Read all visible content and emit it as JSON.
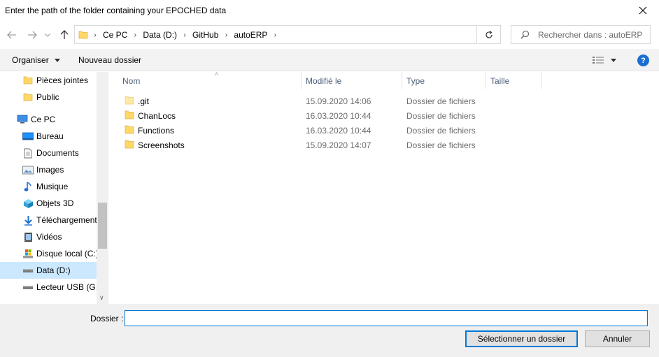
{
  "window": {
    "title": "Enter the path of the folder containing your EPOCHED data"
  },
  "nav": {
    "breadcrumbs": [
      "Ce PC",
      "Data (D:)",
      "GitHub",
      "autoERP"
    ],
    "search_placeholder": "Rechercher dans : autoERP"
  },
  "toolbar": {
    "organize_label": "Organiser",
    "new_folder_label": "Nouveau dossier",
    "help_label": "?"
  },
  "navpane": {
    "items": [
      {
        "label": "Pièces jointes",
        "icon": "folder-icon"
      },
      {
        "label": "Public",
        "icon": "folder-icon"
      },
      {
        "label": "Ce PC",
        "icon": "computer-icon"
      },
      {
        "label": "Bureau",
        "icon": "desktop-icon"
      },
      {
        "label": "Documents",
        "icon": "documents-icon"
      },
      {
        "label": "Images",
        "icon": "images-icon"
      },
      {
        "label": "Musique",
        "icon": "music-icon"
      },
      {
        "label": "Objets 3D",
        "icon": "objects-3d-icon"
      },
      {
        "label": "Téléchargements",
        "icon": "downloads-icon"
      },
      {
        "label": "Vidéos",
        "icon": "videos-icon"
      },
      {
        "label": "Disque local (C:)",
        "icon": "local-disk-icon"
      },
      {
        "label": "Data (D:)",
        "icon": "drive-icon",
        "selected": true
      },
      {
        "label": "Lecteur USB (G:)",
        "icon": "usb-drive-icon"
      }
    ]
  },
  "filelist": {
    "columns": [
      "Nom",
      "Modifié le",
      "Type",
      "Taille"
    ],
    "rows": [
      {
        "name": ".git",
        "date": "15.09.2020 14:06",
        "type": "Dossier de fichiers",
        "size": ""
      },
      {
        "name": "ChanLocs",
        "date": "16.03.2020 10:44",
        "type": "Dossier de fichiers",
        "size": ""
      },
      {
        "name": "Functions",
        "date": "16.03.2020 10:44",
        "type": "Dossier de fichiers",
        "size": ""
      },
      {
        "name": "Screenshots",
        "date": "15.09.2020 14:07",
        "type": "Dossier de fichiers",
        "size": ""
      }
    ]
  },
  "bottom": {
    "folder_label": "Dossier :",
    "folder_value": "",
    "select_label": "Sélectionner un dossier",
    "cancel_label": "Annuler"
  },
  "colors": {
    "accent": "#0078d7",
    "selection": "#cce8ff",
    "folder": "#ffd866"
  }
}
